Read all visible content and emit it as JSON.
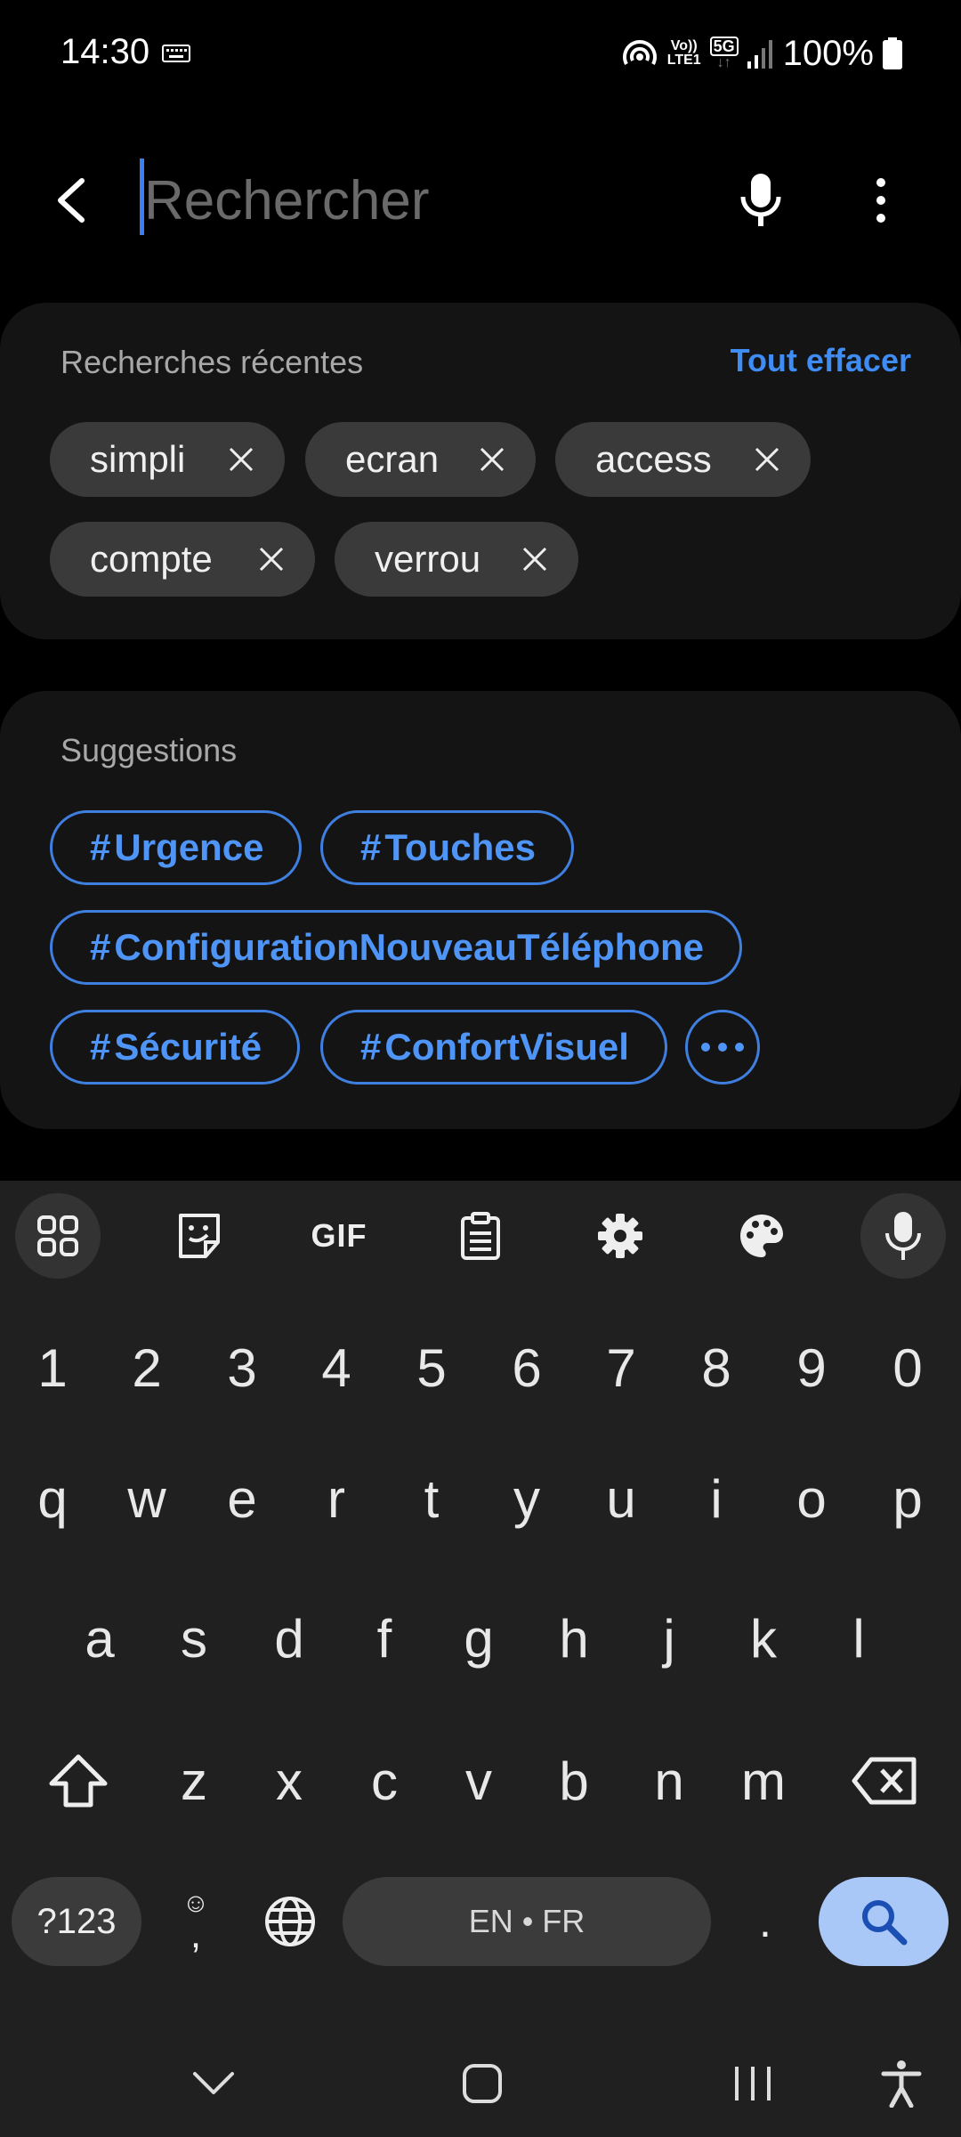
{
  "status": {
    "time": "14:30",
    "battery": "100%",
    "network_5g": "5G",
    "volte": "Vo))",
    "lte": "LTE1"
  },
  "search": {
    "placeholder": "Rechercher",
    "value": ""
  },
  "recent": {
    "title": "Recherches récentes",
    "clear_label": "Tout effacer",
    "items": [
      "simpli",
      "ecran",
      "access",
      "compte",
      "verrou"
    ]
  },
  "suggestions": {
    "title": "Suggestions",
    "hash": "#",
    "tags": [
      "Urgence",
      "Touches",
      "ConfigurationNouveauTéléphone",
      "Sécurité",
      "ConfortVisuel"
    ]
  },
  "keyboard": {
    "gif_label": "GIF",
    "numbers": [
      "1",
      "2",
      "3",
      "4",
      "5",
      "6",
      "7",
      "8",
      "9",
      "0"
    ],
    "row1": [
      "q",
      "w",
      "e",
      "r",
      "t",
      "y",
      "u",
      "i",
      "o",
      "p"
    ],
    "row2": [
      "a",
      "s",
      "d",
      "f",
      "g",
      "h",
      "j",
      "k",
      "l"
    ],
    "row3": [
      "z",
      "x",
      "c",
      "v",
      "b",
      "n",
      "m"
    ],
    "symbols_label": "?123",
    "comma": ",",
    "space_label": "EN • FR",
    "period": "."
  },
  "icons": {
    "back": "back-arrow-icon",
    "mic": "microphone-icon",
    "more": "more-vertical-icon",
    "close": "close-icon",
    "ellipsis": "more-horizontal-icon"
  },
  "colors": {
    "accent": "#3f8cf5",
    "search_key": "#a9c8f7",
    "chip_bg": "#3a3a3a",
    "keyboard_bg": "#202020"
  }
}
